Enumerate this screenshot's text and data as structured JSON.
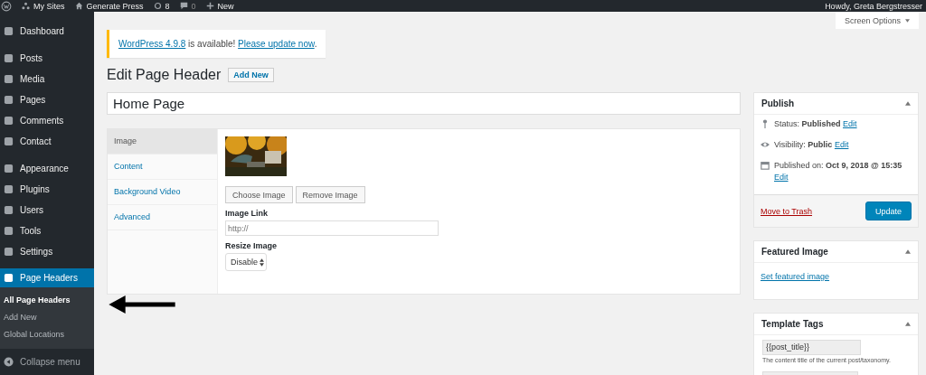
{
  "admin_bar": {
    "items": [
      {
        "kind": "logo"
      },
      {
        "kind": "sites",
        "label": "My Sites"
      },
      {
        "kind": "home",
        "label": "Generate Press"
      },
      {
        "kind": "updates",
        "label": "8"
      },
      {
        "kind": "comments",
        "label": "0"
      },
      {
        "kind": "new",
        "label": "New"
      }
    ],
    "greeting": "Howdy, Greta Bergstresser"
  },
  "sidebar": {
    "groups": [
      [
        {
          "label": "Dashboard",
          "selected": false
        }
      ],
      [
        {
          "label": "Posts",
          "selected": false
        },
        {
          "label": "Media",
          "selected": false
        },
        {
          "label": "Pages",
          "selected": false
        },
        {
          "label": "Comments",
          "selected": false
        },
        {
          "label": "Contact",
          "selected": false
        }
      ],
      [
        {
          "label": "Appearance",
          "selected": false
        },
        {
          "label": "Plugins",
          "selected": false
        },
        {
          "label": "Users",
          "selected": false
        },
        {
          "label": "Tools",
          "selected": false
        },
        {
          "label": "Settings",
          "selected": false
        }
      ],
      [
        {
          "label": "Page Headers",
          "selected": true,
          "children": [
            {
              "label": "All Page Headers",
              "selected": true
            },
            {
              "label": "Add New",
              "selected": false
            },
            {
              "label": "Global Locations",
              "selected": false
            }
          ]
        }
      ]
    ],
    "collapse": "Collapse menu"
  },
  "screen_options": "Screen Options",
  "notice": {
    "link1": "WordPress 4.9.8",
    "text": " is available! ",
    "link2": "Please update now",
    "end": "."
  },
  "heading": "Edit Page Header",
  "add_new": "Add New",
  "title_field": {
    "value": "Home Page"
  },
  "meta_box": {
    "tabs": [
      {
        "label": "Image",
        "selected": true
      },
      {
        "label": "Content",
        "selected": false
      },
      {
        "label": "Background Video",
        "selected": false
      },
      {
        "label": "Advanced",
        "selected": false
      }
    ],
    "image": {
      "kind": "picture"
    },
    "buttons": [
      "Choose Image",
      "Remove Image"
    ],
    "image_link": {
      "label": "Image Link",
      "placeholder": "http://"
    },
    "resize": {
      "label": "Resize Image",
      "value": "Disable"
    }
  },
  "publish": {
    "title": "Publish",
    "rows": [
      {
        "kind": "status",
        "label": "Status: ",
        "value": "Published",
        "edit": "Edit"
      },
      {
        "kind": "visibility",
        "label": "Visibility: ",
        "value": "Public",
        "edit": "Edit"
      },
      {
        "kind": "date",
        "label": "Published on: ",
        "value": "Oct 9, 2018 @ 15:35",
        "edit": "Edit"
      }
    ],
    "trash": "Move to Trash",
    "update": "Update"
  },
  "featured_image": {
    "title": "Featured Image",
    "link": "Set featured image"
  },
  "template_tags": {
    "title": "Template Tags",
    "tag": "{{post_title}}",
    "description": "The content title of the current post/taxonomy."
  }
}
